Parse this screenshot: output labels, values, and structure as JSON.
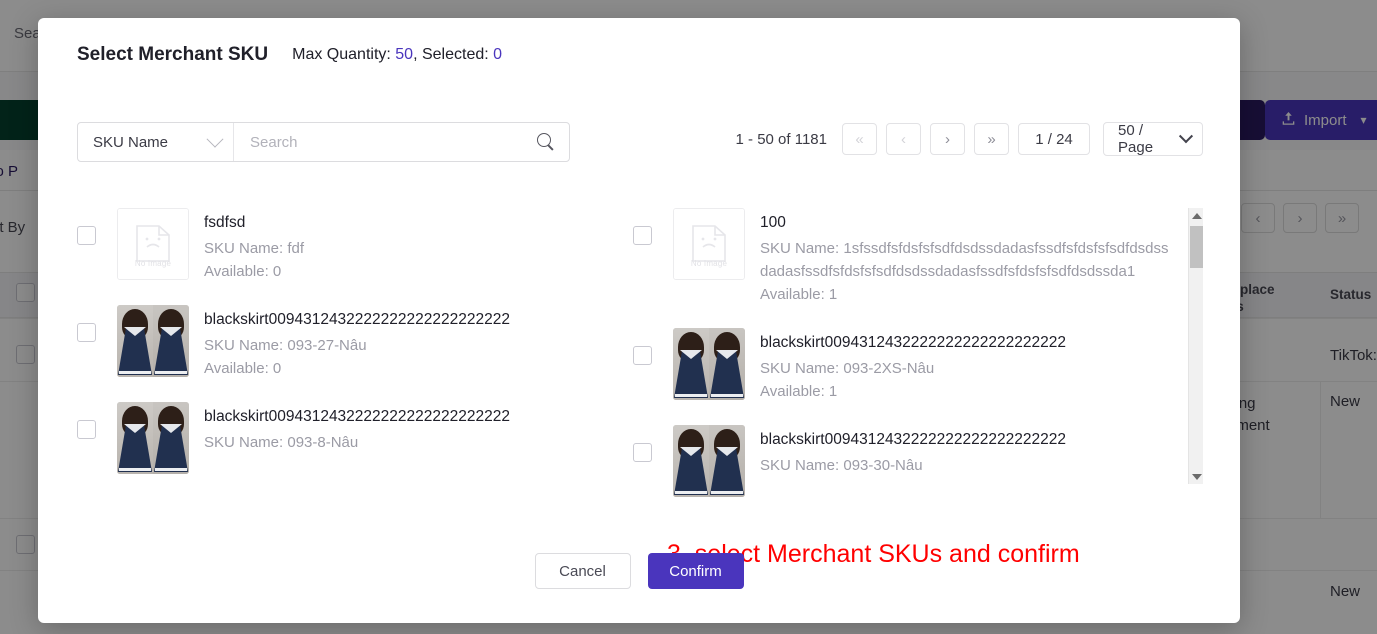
{
  "background": {
    "search_label": "Sea",
    "primary_button_label": "",
    "tab_label": "To P",
    "sort_by_label": "ort By",
    "import_button_label": "Import",
    "import_icon": "upload-icon",
    "pagination": [
      "‹",
      "›",
      "»"
    ],
    "columns": {
      "marketplace_status": "etplace\nus",
      "status": "Status"
    },
    "rows": [
      {
        "marketplace_status": "",
        "status": "TikTok:"
      },
      {
        "marketplace_status": "iting\noment",
        "status": "New"
      },
      {
        "marketplace_status": "",
        "status": ""
      },
      {
        "marketplace_status": "",
        "status": "New"
      }
    ]
  },
  "modal": {
    "title": "Select Merchant SKU",
    "max_quantity_label": "Max Quantity:",
    "max_quantity_value": "50",
    "selected_label": ", Selected:",
    "selected_value": "0",
    "accent_color": "#4a35bd",
    "search": {
      "field_select_value": "SKU Name",
      "field_select_icon": "chevron-down-icon",
      "placeholder": "Search",
      "value": "",
      "search_icon": "search-icon"
    },
    "pagination": {
      "range_label": "1 - 50 of 1181",
      "first_label": "«",
      "prev_label": "‹",
      "next_label": "›",
      "last_label": "»",
      "page_label": "1 / 24",
      "page_size_label": "50 / Page",
      "page_size_icon": "chevron-down-icon"
    },
    "items_left": [
      {
        "title": "fsdfsd",
        "sku_name": "SKU Name: fdf",
        "available": "Available: 0",
        "image": "no-image",
        "no_image_caption": "No Image",
        "checked": false
      },
      {
        "title": "blackskirt0094312432222222222222222222",
        "sku_name": "SKU Name: 093-27-Nâu",
        "available": "Available: 0",
        "image": "product-photo",
        "no_image_caption": "",
        "checked": false
      },
      {
        "title": "blackskirt0094312432222222222222222222",
        "sku_name": "SKU Name: 093-8-Nâu",
        "available": "",
        "image": "product-photo",
        "no_image_caption": "",
        "checked": false
      }
    ],
    "items_right": [
      {
        "title": "100",
        "sku_name": "SKU Name: 1sfssdfsfdsfsfsdfdsdssdadasfssdfsfdsfsfsdfdsdssdadasfssdfsfdsfsfsdfdsdssdadasfssdfsfdsfsfsdfdsdssda1",
        "available": "Available: 1",
        "image": "no-image",
        "no_image_caption": "No Image",
        "checked": false
      },
      {
        "title": "blackskirt0094312432222222222222222222",
        "sku_name": "SKU Name: 093-2XS-Nâu",
        "available": "Available: 1",
        "image": "product-photo",
        "no_image_caption": "",
        "checked": false
      },
      {
        "title": "blackskirt0094312432222222222222222222",
        "sku_name": "SKU Name: 093-30-Nâu",
        "available": "",
        "image": "product-photo",
        "no_image_caption": "",
        "checked": false
      }
    ],
    "annotation": "3. select Merchant SKUs and confirm",
    "annotation_color": "#ff0000",
    "cancel_label": "Cancel",
    "confirm_label": "Confirm"
  }
}
